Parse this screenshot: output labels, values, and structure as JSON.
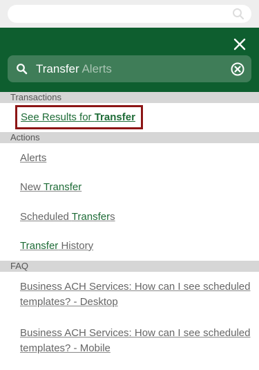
{
  "search": {
    "typed": "Transfer",
    "suggestion": " Alerts"
  },
  "sections": {
    "transactions": "Transactions",
    "actions": "Actions",
    "faq": "FAQ"
  },
  "results": {
    "prefix": "See Results for ",
    "term": "Transfer"
  },
  "actions": {
    "alerts": "Alerts",
    "new_transfer_a": "New ",
    "new_transfer_b": "Transfer",
    "scheduled_a": "Scheduled ",
    "scheduled_b": "Transfer",
    "scheduled_c": "s",
    "history_a": "Transfer",
    "history_b": " History"
  },
  "faq": {
    "item1": "Business ACH Services: How can I see scheduled templates? - Desktop",
    "item2": "Business ACH Services: How can I see scheduled templates? - Mobile"
  },
  "icons": {
    "top_search": "search-icon",
    "close": "close-icon",
    "search": "search-icon",
    "clear": "clear-circle-icon"
  },
  "colors": {
    "brand_green": "#0e5e2f",
    "highlight_red": "#8c1515",
    "link_green": "#1d6b36"
  }
}
